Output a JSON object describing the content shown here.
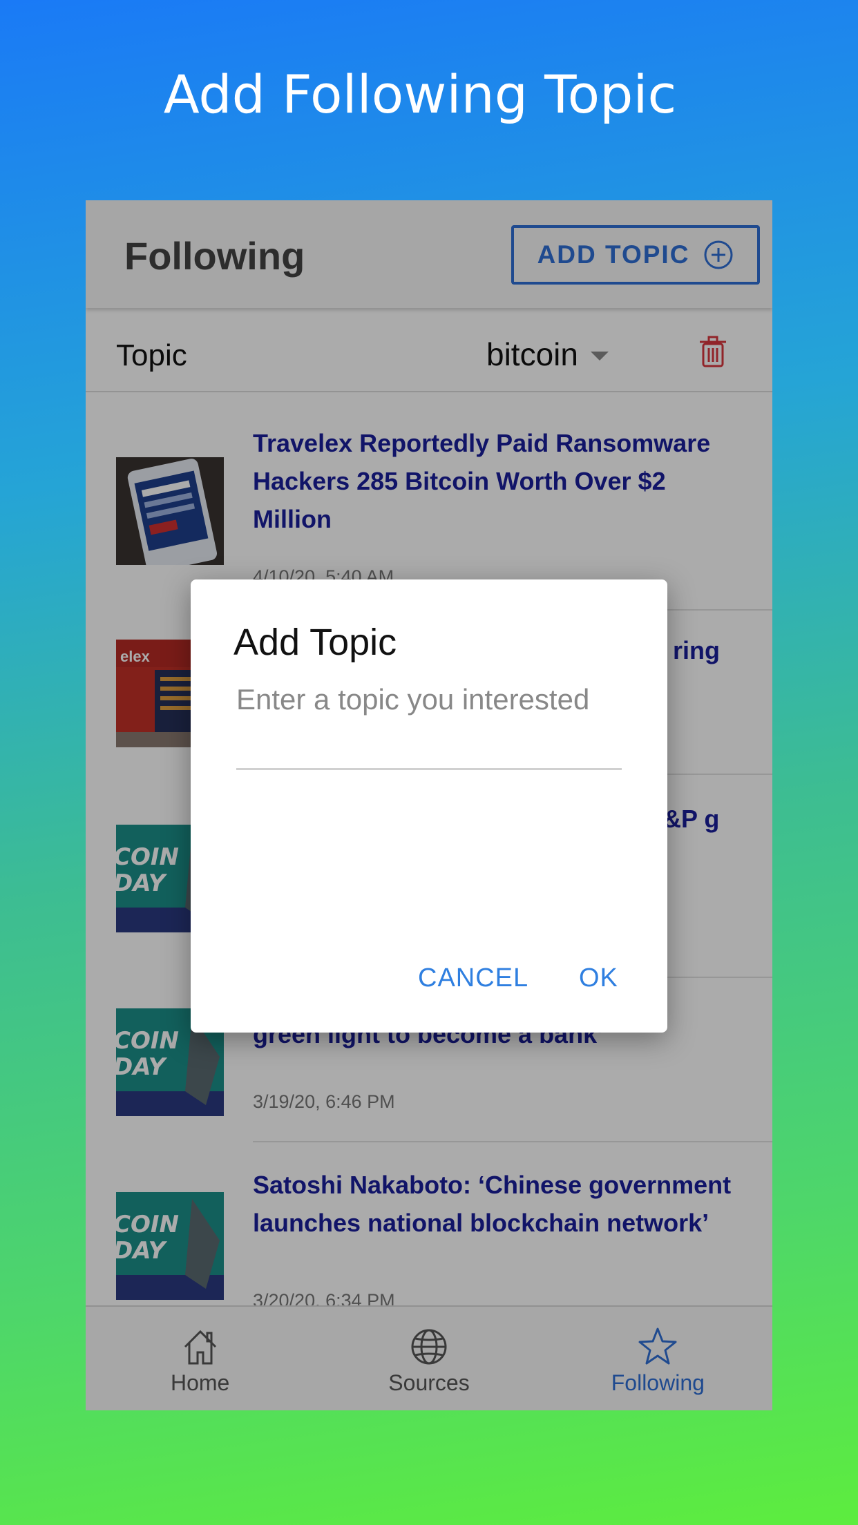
{
  "promo": {
    "title": "Add Following Topic"
  },
  "header": {
    "title": "Following",
    "add_topic_label": "ADD TOPIC"
  },
  "topic_bar": {
    "label": "Topic",
    "selected": "bitcoin"
  },
  "news": [
    {
      "headline": "Travelex Reportedly Paid Ransomware Hackers 285 Bitcoin Worth Over $2 Million",
      "date": "4/10/20, 5:40 AM"
    },
    {
      "headline": "ring",
      "date": ""
    },
    {
      "headline": "&P g",
      "date": ""
    },
    {
      "headline": "green light to become a bank’",
      "date": "3/19/20, 6:46 PM"
    },
    {
      "headline": "Satoshi Nakaboto: ‘Chinese government launches national blockchain network’",
      "date": "3/20/20, 6:34 PM"
    }
  ],
  "nav": {
    "home": "Home",
    "sources": "Sources",
    "following": "Following"
  },
  "dialog": {
    "title": "Add Topic",
    "placeholder": "Enter a topic you interested",
    "cancel": "CANCEL",
    "ok": "OK"
  },
  "colors": {
    "accent": "#2f6fd6",
    "headline": "#1a1f9c",
    "delete": "#d9363e"
  }
}
